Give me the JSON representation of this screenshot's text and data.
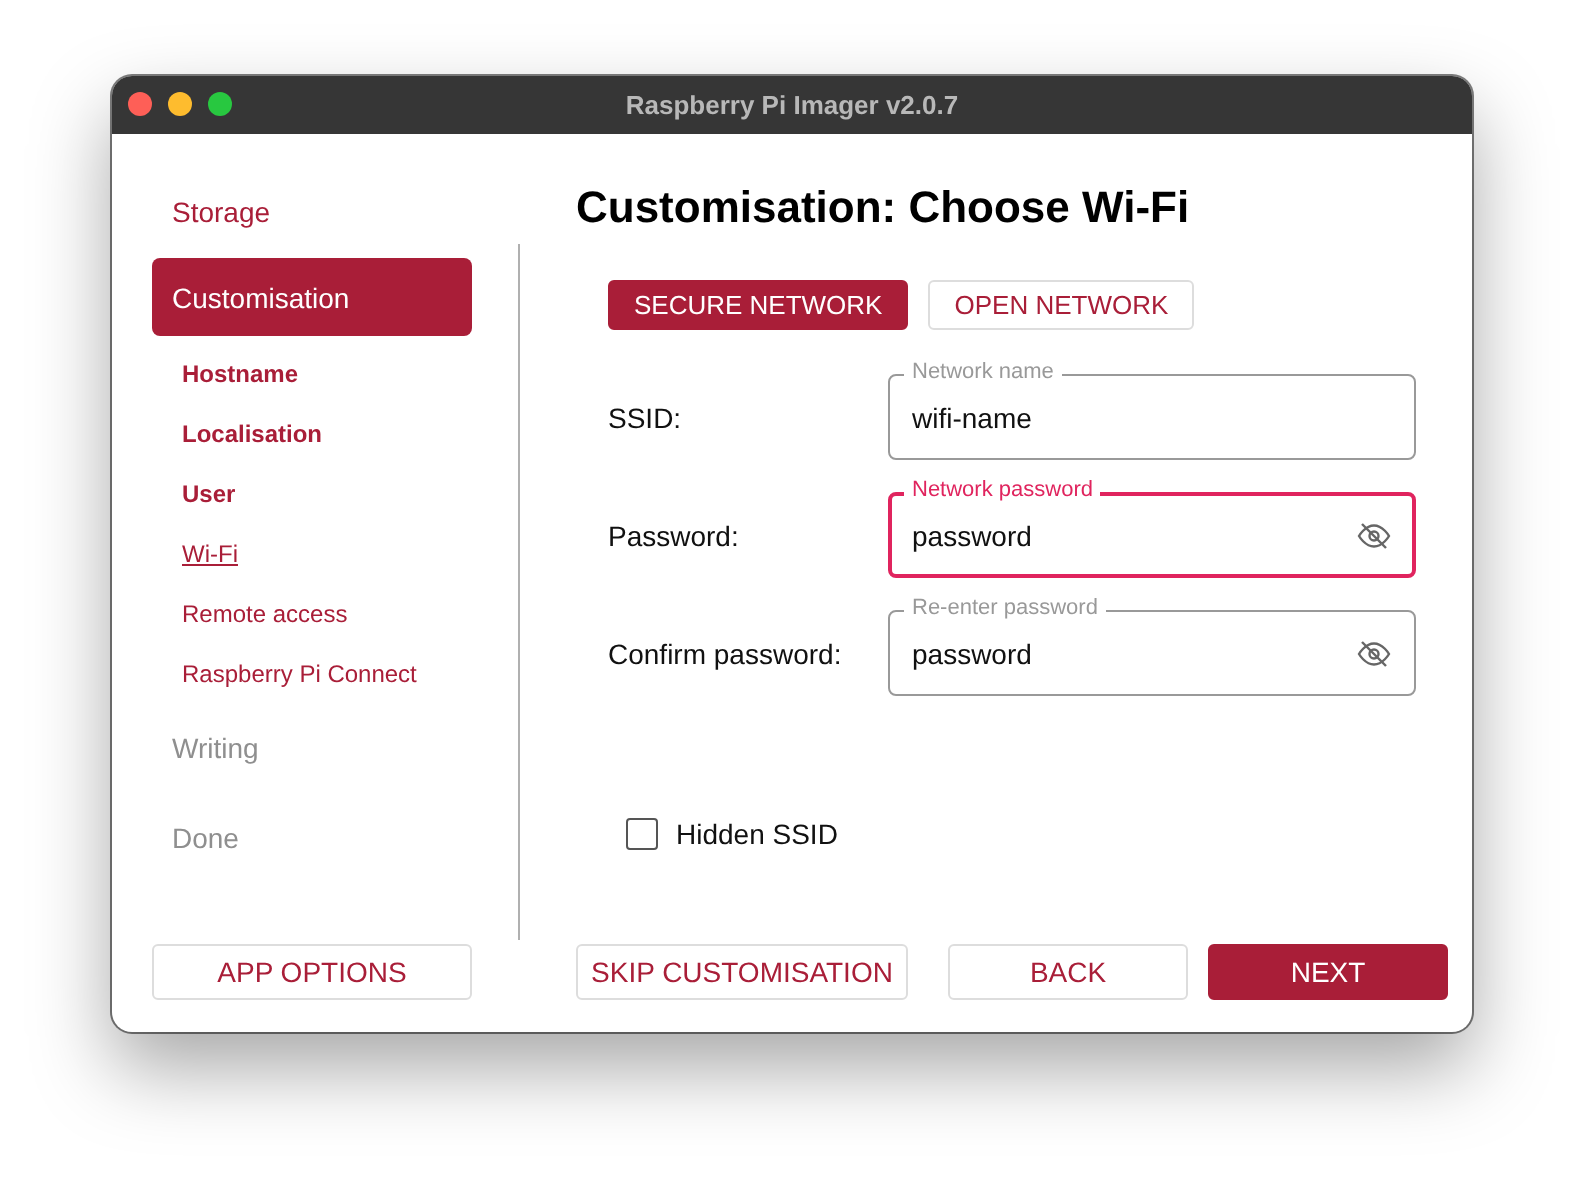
{
  "window": {
    "title": "Raspberry Pi Imager v2.0.7"
  },
  "sidebar": {
    "steps": [
      {
        "label": "Storage",
        "disabled": false,
        "selected": false
      },
      {
        "label": "Customisation",
        "disabled": false,
        "selected": true,
        "children": [
          {
            "label": "Hostname",
            "completed": true,
            "selected": false
          },
          {
            "label": "Localisation",
            "completed": true,
            "selected": false
          },
          {
            "label": "User",
            "completed": true,
            "selected": false
          },
          {
            "label": "Wi-Fi",
            "completed": false,
            "selected": true
          },
          {
            "label": "Remote access",
            "completed": false,
            "selected": false
          },
          {
            "label": "Raspberry Pi Connect",
            "completed": false,
            "selected": false
          }
        ]
      },
      {
        "label": "Writing",
        "disabled": true,
        "selected": false
      },
      {
        "label": "Done",
        "disabled": true,
        "selected": false
      }
    ]
  },
  "heading": "Customisation: Choose Wi-Fi",
  "network_types": [
    {
      "label": "SECURE NETWORK",
      "selected": true
    },
    {
      "label": "OPEN NETWORK",
      "selected": false
    }
  ],
  "fields": [
    {
      "label": "SSID:",
      "floating_label": "Network name",
      "value": "wifi-name",
      "focused": false,
      "kind": "text"
    },
    {
      "label": "Password:",
      "floating_label": "Network password",
      "value": "password",
      "focused": true,
      "kind": "password"
    },
    {
      "label": "Confirm password:",
      "floating_label": "Re-enter password",
      "value": "password",
      "focused": false,
      "kind": "password"
    }
  ],
  "hidden_ssid": {
    "label": "Hidden SSID",
    "checked": false
  },
  "buttons": [
    {
      "label": "APP OPTIONS",
      "kind": "outline"
    },
    {
      "label": "SKIP CUSTOMISATION",
      "kind": "outline"
    },
    {
      "label": "BACK",
      "kind": "outline"
    },
    {
      "label": "NEXT",
      "kind": "primary"
    }
  ]
}
